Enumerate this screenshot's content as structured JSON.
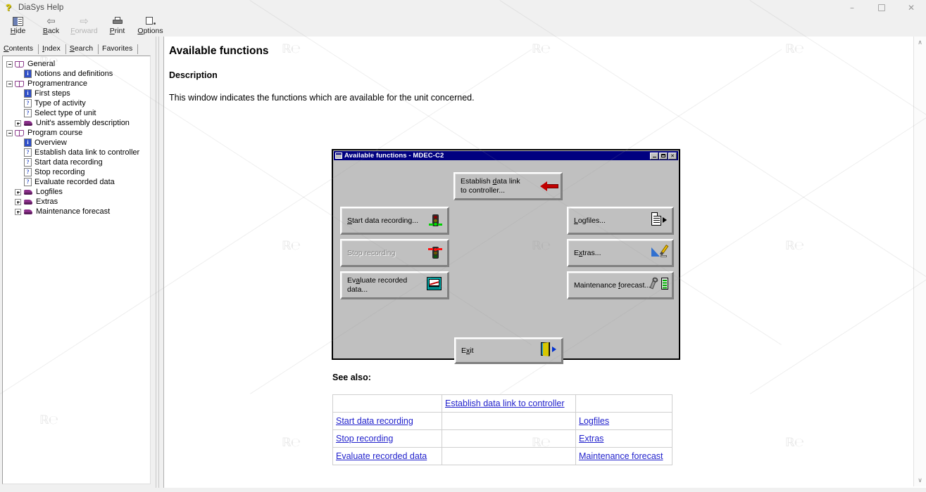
{
  "window": {
    "title": "DiaSys Help",
    "app_icon": "help-question-icon",
    "controls": {
      "minimize": "–",
      "maximize": "□",
      "close": "✕"
    }
  },
  "toolbar": {
    "buttons": [
      {
        "id": "hide",
        "label": "Hide",
        "accel": "H",
        "icon": "hide-pane-icon",
        "disabled": false
      },
      {
        "id": "back",
        "label": "Back",
        "accel": "B",
        "icon": "back-arrow-icon",
        "disabled": false
      },
      {
        "id": "forward",
        "label": "Forward",
        "accel": "F",
        "icon": "forward-arrow-icon",
        "disabled": true
      },
      {
        "id": "print",
        "label": "Print",
        "accel": "P",
        "icon": "printer-icon",
        "disabled": false
      },
      {
        "id": "options",
        "label": "Options",
        "accel": "O",
        "icon": "options-icon",
        "disabled": false
      }
    ]
  },
  "sidebar": {
    "tabs": [
      {
        "label": "Contents",
        "accel": "C",
        "active": true
      },
      {
        "label": "Index",
        "accel": "I",
        "active": false
      },
      {
        "label": "Search",
        "accel": "S",
        "active": false
      },
      {
        "label": "Favorites",
        "accel": "F",
        "active": false
      }
    ],
    "tree": [
      {
        "label": "General",
        "icon": "open-book-icon",
        "twist": "minus",
        "level": 0
      },
      {
        "label": "Notions and definitions",
        "icon": "info-page-icon",
        "twist": "none",
        "level": 1
      },
      {
        "label": "Programentrance",
        "icon": "open-book-icon",
        "twist": "minus",
        "level": 0
      },
      {
        "label": "First steps",
        "icon": "info-page-icon",
        "twist": "none",
        "level": 1
      },
      {
        "label": "Type of activity",
        "icon": "question-page-icon",
        "twist": "none",
        "level": 1
      },
      {
        "label": "Select type of unit",
        "icon": "question-page-icon",
        "twist": "none",
        "level": 1
      },
      {
        "label": "Unit's assembly description",
        "icon": "closed-book-icon",
        "twist": "plus",
        "level": 1
      },
      {
        "label": "Program course",
        "icon": "open-book-icon",
        "twist": "minus",
        "level": 0
      },
      {
        "label": "Overview",
        "icon": "info-page-icon",
        "twist": "none",
        "level": 1
      },
      {
        "label": "Establish data link to controller",
        "icon": "question-page-icon",
        "twist": "none",
        "level": 1
      },
      {
        "label": "Start data recording",
        "icon": "question-page-icon",
        "twist": "none",
        "level": 1
      },
      {
        "label": "Stop recording",
        "icon": "question-page-icon",
        "twist": "none",
        "level": 1
      },
      {
        "label": "Evaluate recorded data",
        "icon": "question-page-icon",
        "twist": "none",
        "level": 1
      },
      {
        "label": "Logfiles",
        "icon": "closed-book-icon",
        "twist": "plus",
        "level": 1
      },
      {
        "label": "Extras",
        "icon": "closed-book-icon",
        "twist": "plus",
        "level": 1
      },
      {
        "label": "Maintenance forecast",
        "icon": "closed-book-icon",
        "twist": "plus",
        "level": 1
      }
    ]
  },
  "content": {
    "title": "Available functions",
    "section_heading": "Description",
    "paragraph": "This window indicates the functions which are available for the unit concerned.",
    "see_also_heading": "See also:"
  },
  "dialog_screenshot": {
    "titlebar": {
      "caption": "Available functions - MDEC-C2",
      "sysmenu_icon": "system-menu-icon",
      "minimize": "minimize-icon",
      "maximize": "maximize-icon",
      "close": "close-icon"
    },
    "buttons": [
      {
        "id": "establish-link",
        "label": "Establish data link\nto controller...",
        "accel": "d",
        "icon": "red-left-arrow-icon",
        "disabled": false
      },
      {
        "id": "start-recording",
        "label": "Start data recording...",
        "accel": "S",
        "icon": "traffic-light-green-icon",
        "disabled": false
      },
      {
        "id": "stop-recording",
        "label": "Stop recording",
        "accel": "",
        "icon": "traffic-light-red-icon",
        "disabled": true
      },
      {
        "id": "evaluate-data",
        "label": "Evaluate recorded data...",
        "accel": "a",
        "icon": "chart-window-icon",
        "disabled": false
      },
      {
        "id": "logfiles",
        "label": "Logfiles...",
        "accel": "L",
        "icon": "document-out-icon",
        "disabled": false
      },
      {
        "id": "extras",
        "label": "Extras...",
        "accel": "x",
        "icon": "pencil-ruler-icon",
        "disabled": false
      },
      {
        "id": "maintenance",
        "label": "Maintenance forecast...",
        "accel": "f",
        "icon": "wrench-battery-icon",
        "disabled": false
      },
      {
        "id": "exit",
        "label": "Exit",
        "accel": "x",
        "icon": "exit-door-icon",
        "disabled": false
      }
    ]
  },
  "see_also": {
    "rows": [
      {
        "left": "",
        "middle": "Establish data link to controller",
        "right": ""
      },
      {
        "left": "Start data recording",
        "middle": "",
        "right": "Logfiles"
      },
      {
        "left": "Stop recording",
        "middle": "",
        "right": "Extras"
      },
      {
        "left": "Evaluate recorded data",
        "middle": "",
        "right": "Maintenance forecast"
      }
    ]
  },
  "scrollbar": {
    "up_arrow": "∧",
    "down_arrow": "∨"
  },
  "colors": {
    "titlebar_navy": "#000080",
    "dialog_face": "#c0c0c0",
    "link_blue": "#2222cc",
    "tree_icon_purple": "#8a2f8a",
    "chrome_gray": "#f0f0f0"
  }
}
